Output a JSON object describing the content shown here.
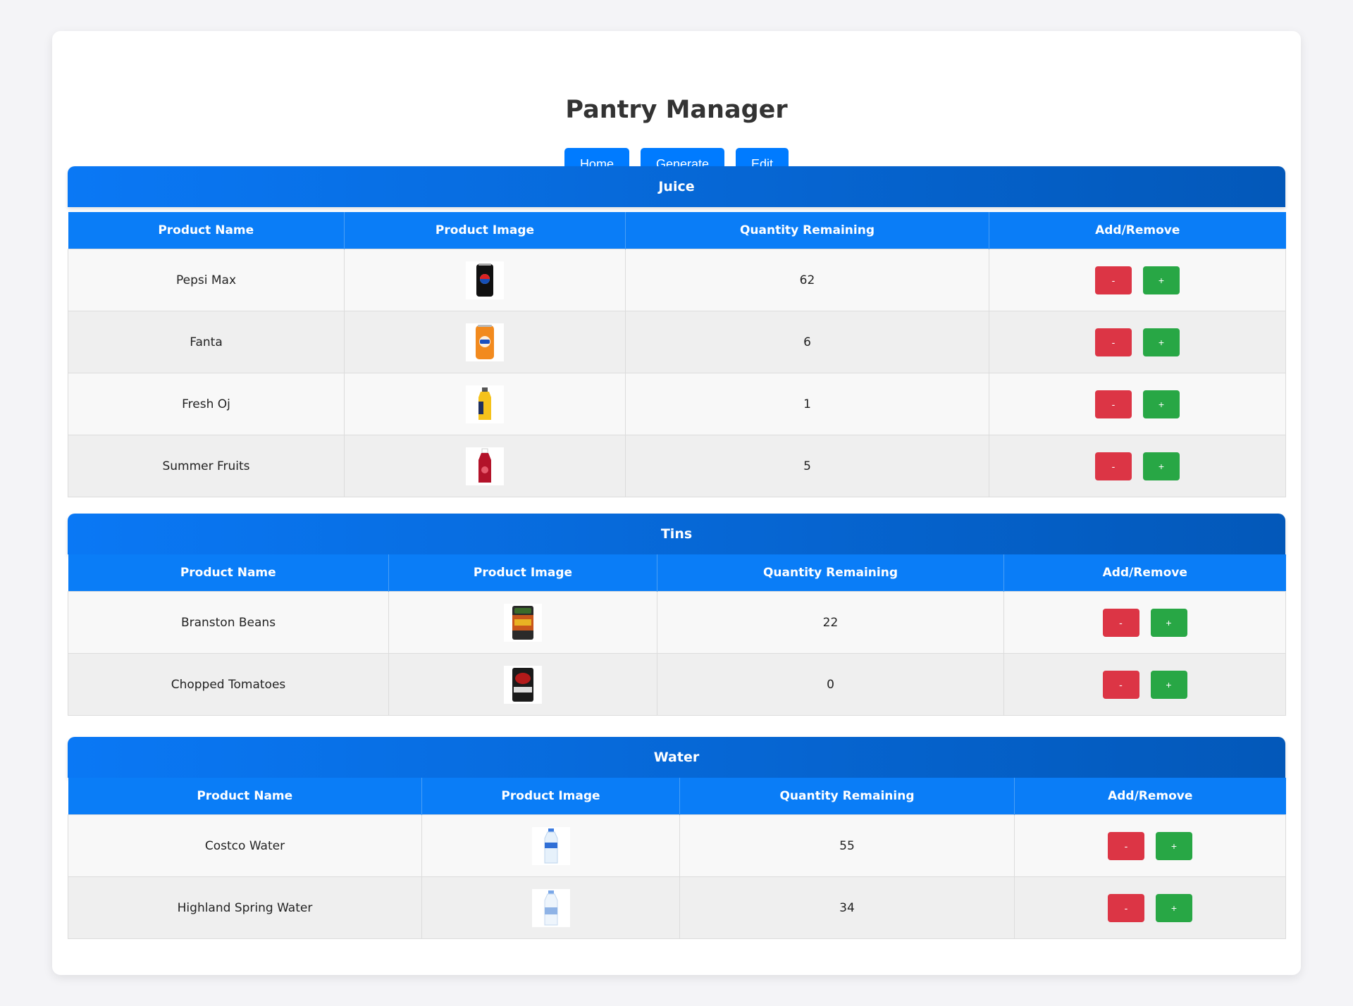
{
  "app": {
    "title": "Pantry Manager"
  },
  "nav": {
    "home": "Home",
    "generate": "Generate",
    "edit": "Edit"
  },
  "columns": {
    "name": "Product Name",
    "image": "Product Image",
    "quantity": "Quantity Remaining",
    "actions": "Add/Remove"
  },
  "buttons": {
    "remove": "-",
    "add": "+"
  },
  "sections": [
    {
      "title": "Juice",
      "items": [
        {
          "name": "Pepsi Max",
          "quantity": "62",
          "image_icon": "pepsi-can-icon"
        },
        {
          "name": "Fanta",
          "quantity": "6",
          "image_icon": "fanta-can-icon"
        },
        {
          "name": "Fresh Oj",
          "quantity": "1",
          "image_icon": "orange-juice-bottle-icon"
        },
        {
          "name": "Summer Fruits",
          "quantity": "5",
          "image_icon": "squash-bottle-icon"
        }
      ]
    },
    {
      "title": "Tins",
      "items": [
        {
          "name": "Branston Beans",
          "quantity": "22",
          "image_icon": "beans-tin-icon"
        },
        {
          "name": "Chopped Tomatoes",
          "quantity": "0",
          "image_icon": "tomato-tin-icon"
        }
      ]
    },
    {
      "title": "Water",
      "items": [
        {
          "name": "Costco Water",
          "quantity": "55",
          "image_icon": "water-bottle-icon"
        },
        {
          "name": "Highland Spring Water",
          "quantity": "34",
          "image_icon": "water-bottle-icon"
        }
      ]
    }
  ],
  "colors": {
    "primary": "#007bff",
    "header_gradient_start": "#0a78f5",
    "header_gradient_end": "#0358b9",
    "remove": "#dc3545",
    "add": "#28a745"
  }
}
